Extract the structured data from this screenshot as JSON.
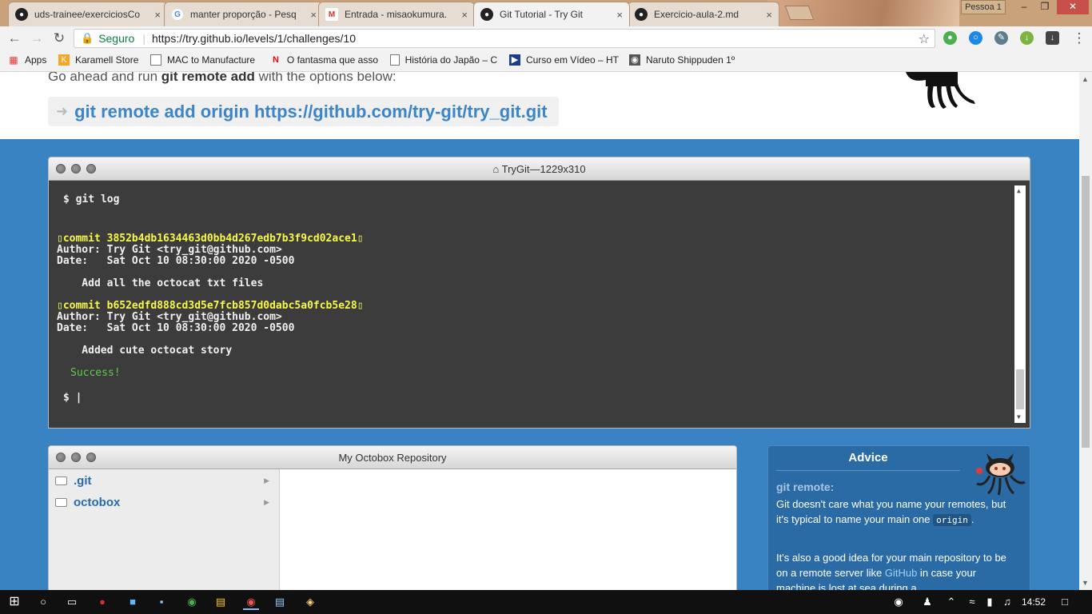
{
  "browser": {
    "tabs": [
      {
        "title": "uds-trainee/exerciciosCo",
        "icon": "github-icon",
        "active": false
      },
      {
        "title": "manter proporção - Pesq",
        "icon": "google-icon",
        "active": false
      },
      {
        "title": "Entrada - misaokumura.",
        "icon": "gmail-icon",
        "active": false
      },
      {
        "title": "Git Tutorial - Try Git",
        "icon": "github-icon",
        "active": true
      },
      {
        "title": "Exercicio-aula-2.md",
        "icon": "github-icon",
        "active": false
      }
    ],
    "tab_close_glyph": "×",
    "profile_label": "Pessoa 1",
    "window_buttons": [
      "–",
      "❐",
      "✕"
    ],
    "secure_label": "Seguro",
    "url": "https://try.github.io/levels/1/challenges/10",
    "bookmarks": [
      {
        "label": "Apps",
        "icon": "apps-grid-icon"
      },
      {
        "label": "Karamell Store",
        "icon": "karamell-icon"
      },
      {
        "label": "MAC to Manufacture",
        "icon": "page-icon"
      },
      {
        "label": "O fantasma que asso",
        "icon": "netflix-icon"
      },
      {
        "label": "História do Japão – C",
        "icon": "page-icon"
      },
      {
        "label": "Curso em Vídeo – HT",
        "icon": "cursoemvideo-icon"
      },
      {
        "label": "Naruto Shippuden 1º",
        "icon": "naruto-icon"
      }
    ]
  },
  "instructions": {
    "lead_before": "Go ahead and run ",
    "lead_bold": "git remote add",
    "lead_after": " with the options below:",
    "command": "git remote add origin https://github.com/try-git/try_git.git"
  },
  "terminal": {
    "title": "TryGit—1229x310",
    "lines": {
      "prompt1": "$ git log",
      "commit1": "commit 3852b4db1634463d0bb4d267edb7b3f9cd02ace1",
      "author1": "Author: Try Git <try_git@github.com>",
      "date1": "Date:   Sat Oct 10 08:30:00 2020 -0500",
      "msg1": "    Add all the octocat txt files",
      "commit2": "commit b652edfd888cd3d5e7fcb857d0dabc5a0fcb5e28",
      "author2": "Author: Try Git <try_git@github.com>",
      "date2": "Date:   Sat Oct 10 08:30:00 2020 -0500",
      "msg2": "    Added cute octocat story",
      "success": "Success!",
      "prompt2": "$ |"
    }
  },
  "repo": {
    "title": "My Octobox Repository",
    "folders": [
      ".git",
      "octobox"
    ]
  },
  "advice": {
    "heading": "Advice",
    "subheading": "git remote:",
    "p1_before": "Git doesn't care what you name your remotes, but it's typical to name your main one ",
    "p1_code": "origin",
    "p1_after": ".",
    "p2_before": "It's also a good idea for your main repository to be on a remote server like ",
    "p2_link": "GitHub",
    "p2_after": " in case your machine is lost at sea during a"
  },
  "taskbar": {
    "clock": "14:52"
  },
  "colors": {
    "page_bg": "#3a83c3",
    "command_blue": "#3d85c6",
    "terminal_bg": "#3c3c3c",
    "commit_yellow": "#f8f84a",
    "success_green": "#62c94a"
  }
}
